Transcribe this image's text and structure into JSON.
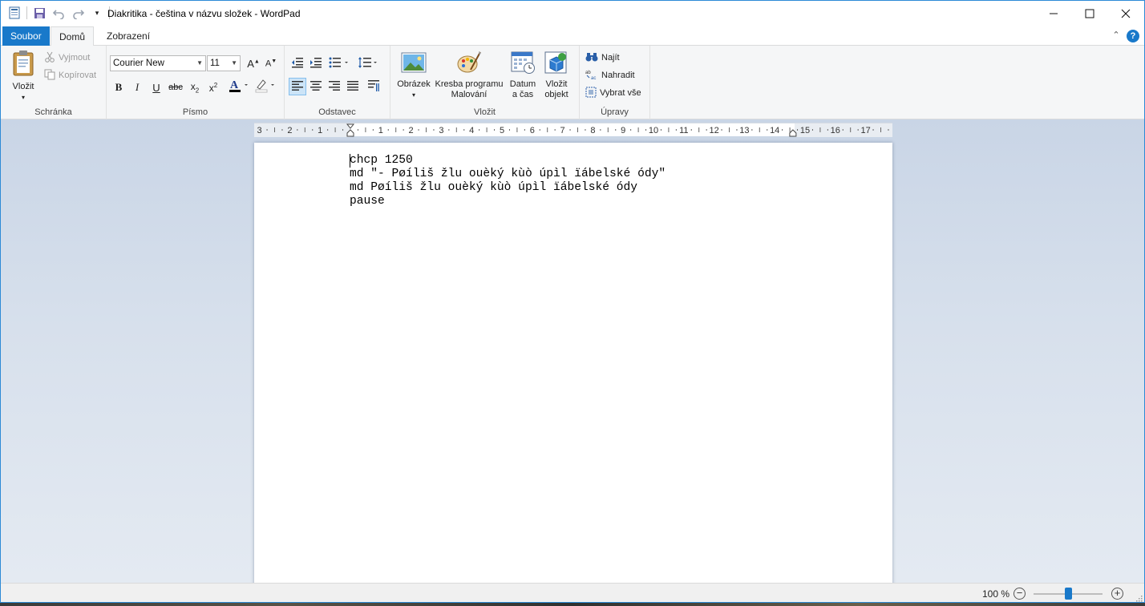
{
  "window": {
    "title": "Diakritika - čeština v názvu složek - WordPad"
  },
  "tabs": {
    "file": "Soubor",
    "home": "Domů",
    "view": "Zobrazení"
  },
  "ribbon": {
    "clipboard": {
      "group_label": "Schránka",
      "paste_label": "Vložit",
      "cut_label": "Vyjmout",
      "copy_label": "Kopírovat"
    },
    "font": {
      "group_label": "Písmo",
      "family": "Courier New",
      "size": "11"
    },
    "paragraph": {
      "group_label": "Odstavec"
    },
    "insert": {
      "group_label": "Vložit",
      "picture_label": "Obrázek",
      "paint_label_line1": "Kresba programu",
      "paint_label_line2": "Malování",
      "datetime_label_line1": "Datum",
      "datetime_label_line2": "a čas",
      "object_label_line1": "Vložit",
      "object_label_line2": "objekt"
    },
    "editing": {
      "group_label": "Úpravy",
      "find_label": "Najít",
      "replace_label": "Nahradit",
      "select_all_label": "Vybrat vše"
    }
  },
  "ruler": {
    "labels": [
      "3",
      "2",
      "1",
      "1",
      "2",
      "3",
      "4",
      "5",
      "6",
      "7",
      "8",
      "9",
      "10",
      "11",
      "12",
      "13",
      "14",
      "15",
      "16",
      "17"
    ]
  },
  "document": {
    "lines": [
      "chcp 1250",
      "md \"- Pøíliš žlu ouèký kùò úpìl ïábelské ódy\"",
      "md Pøíliš žlu ouèký kùò úpìl ïábelské ódy",
      "pause"
    ]
  },
  "statusbar": {
    "zoom": "100 %",
    "zoom_fraction": 0.5
  },
  "colors": {
    "accent": "#1979ca",
    "ribbon_bg": "#f5f6f7",
    "workspace_top": "#c9d5e6"
  }
}
